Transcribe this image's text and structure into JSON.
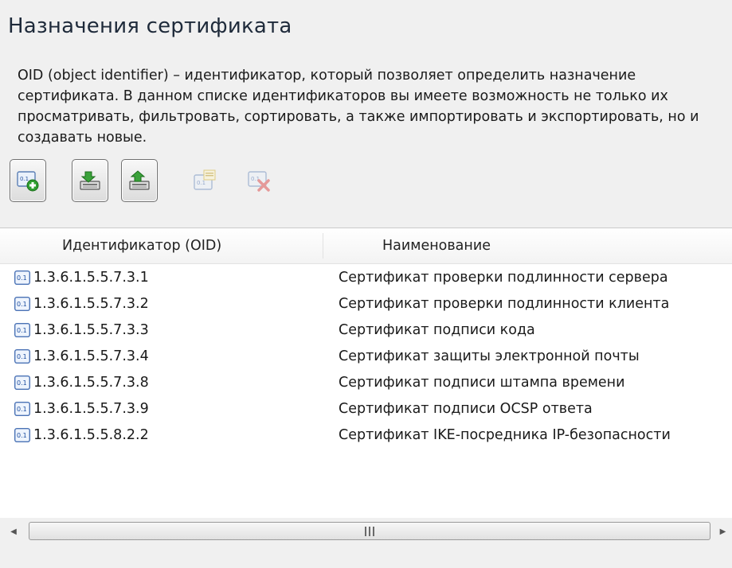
{
  "page": {
    "title": "Назначения сертификата",
    "description": "OID (object identifier) – идентификатор, который позволяет определить назначение сертификата. В данном списке идентификаторов вы имеете возможность не только их просматривать, фильтровать, сортировать, а также импортировать и экспортировать, но и создавать новые."
  },
  "toolbar": {
    "buttons": [
      {
        "icon": "oid-add-icon",
        "enabled": true
      },
      {
        "icon": "import-icon",
        "enabled": true
      },
      {
        "icon": "export-icon",
        "enabled": true
      },
      {
        "icon": "oid-properties-icon",
        "enabled": false
      },
      {
        "icon": "oid-delete-icon",
        "enabled": false
      }
    ]
  },
  "table": {
    "columns": [
      "Идентификатор (OID)",
      "Наименование"
    ],
    "rows": [
      {
        "oid": "1.3.6.1.5.5.7.3.1",
        "name": "Сертификат проверки подлинности сервера"
      },
      {
        "oid": "1.3.6.1.5.5.7.3.2",
        "name": "Сертификат проверки подлинности клиента"
      },
      {
        "oid": "1.3.6.1.5.5.7.3.3",
        "name": "Сертификат подписи кода"
      },
      {
        "oid": "1.3.6.1.5.5.7.3.4",
        "name": "Сертификат защиты электронной почты"
      },
      {
        "oid": "1.3.6.1.5.5.7.3.8",
        "name": "Сертификат подписи штампа времени"
      },
      {
        "oid": "1.3.6.1.5.5.7.3.9",
        "name": "Сертификат подписи OCSP ответа"
      },
      {
        "oid": "1.3.6.1.5.5.8.2.2",
        "name": "Сертификат IKE-посредника IP-безопасности"
      }
    ],
    "row_icon": "oid-icon",
    "icon_text": "0.1"
  },
  "scrollbar": {
    "left_arrow": "◀",
    "right_arrow": "▶"
  }
}
